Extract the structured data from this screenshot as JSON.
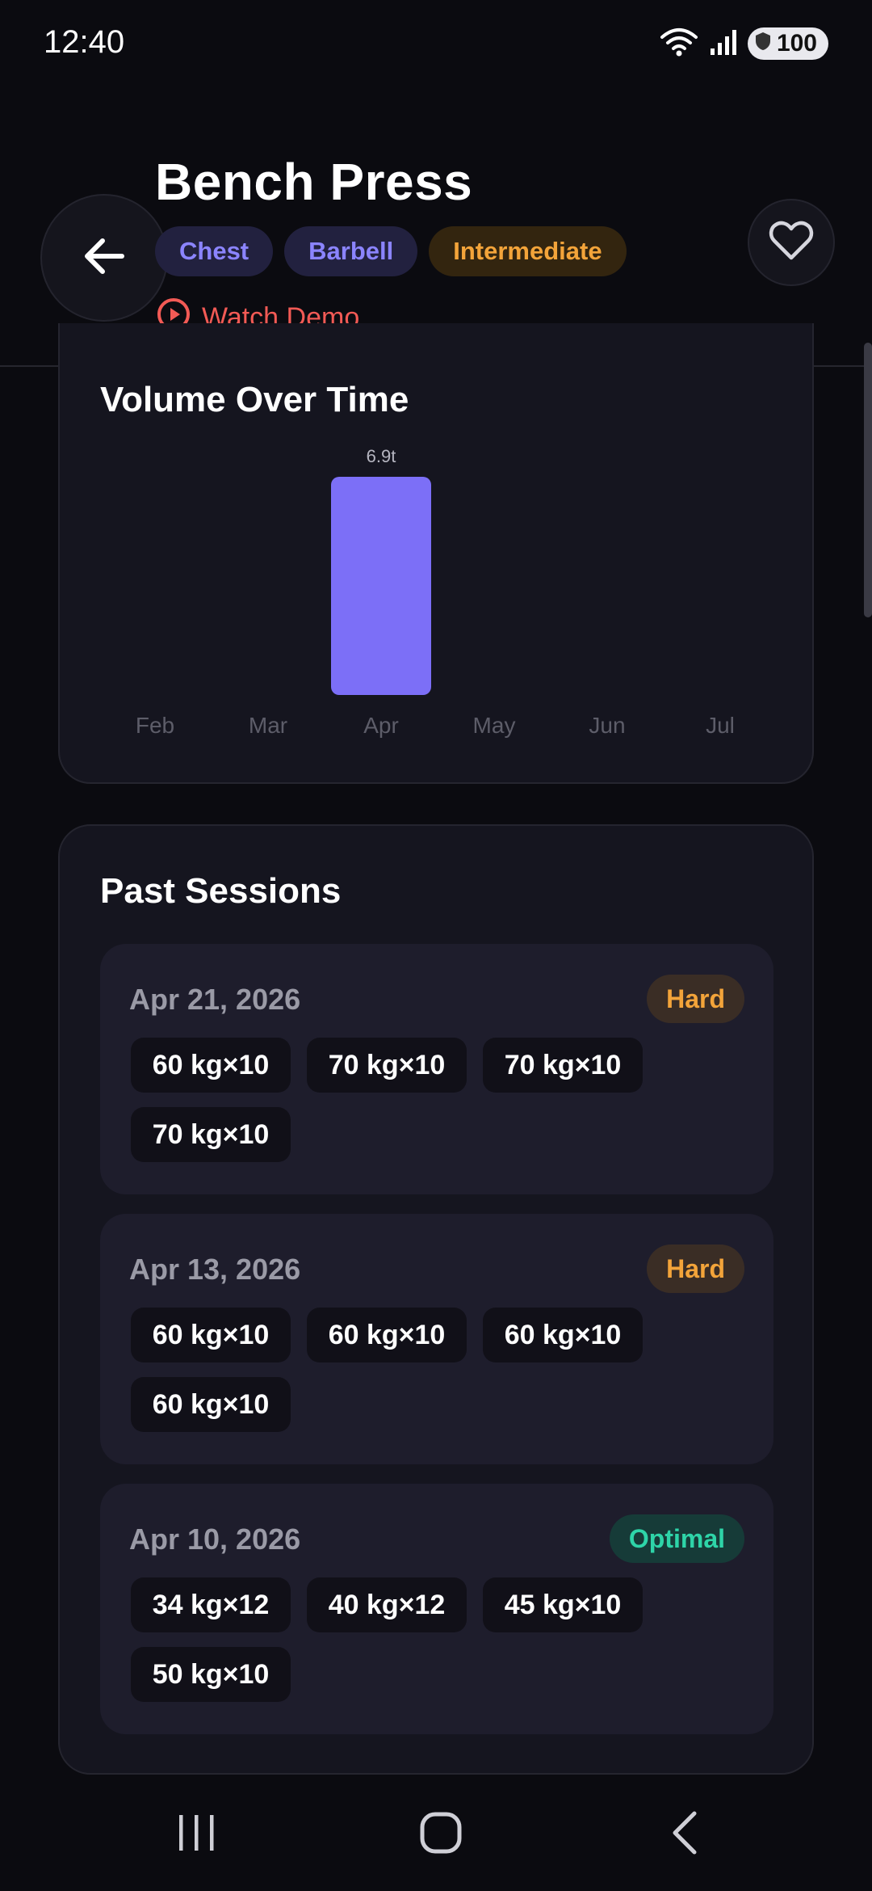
{
  "status_bar": {
    "time": "12:40",
    "battery": "100"
  },
  "header": {
    "title": "Bench Press",
    "tags": [
      "Chest",
      "Barbell",
      "Intermediate"
    ],
    "demo_label": "Watch Demo"
  },
  "chart_card": {
    "title": "Volume Over Time"
  },
  "chart_data": {
    "type": "bar",
    "categories": [
      "Feb",
      "Mar",
      "Apr",
      "May",
      "Jun",
      "Jul"
    ],
    "values": [
      0,
      0,
      6.9,
      0,
      0,
      0
    ],
    "value_labels": [
      "",
      "",
      "6.9t",
      "",
      "",
      ""
    ],
    "ylabel": "",
    "ylim": [
      0,
      6.9
    ],
    "bar_color": "#7c6ff7"
  },
  "sessions": {
    "title": "Past Sessions",
    "items": [
      {
        "date": "Apr 21, 2026",
        "badge": "Hard",
        "badge_type": "hard",
        "sets": [
          "60 kg×10",
          "70 kg×10",
          "70 kg×10",
          "70 kg×10"
        ]
      },
      {
        "date": "Apr 13, 2026",
        "badge": "Hard",
        "badge_type": "hard",
        "sets": [
          "60 kg×10",
          "60 kg×10",
          "60 kg×10",
          "60 kg×10"
        ]
      },
      {
        "date": "Apr 10, 2026",
        "badge": "Optimal",
        "badge_type": "optimal",
        "sets": [
          "34 kg×12",
          "40 kg×12",
          "45 kg×10",
          "50 kg×10"
        ]
      }
    ]
  },
  "colors": {
    "accent_purple": "#8b84ff",
    "accent_orange": "#f3a43a",
    "accent_red": "#f25a55",
    "accent_green": "#2ed4a8"
  }
}
